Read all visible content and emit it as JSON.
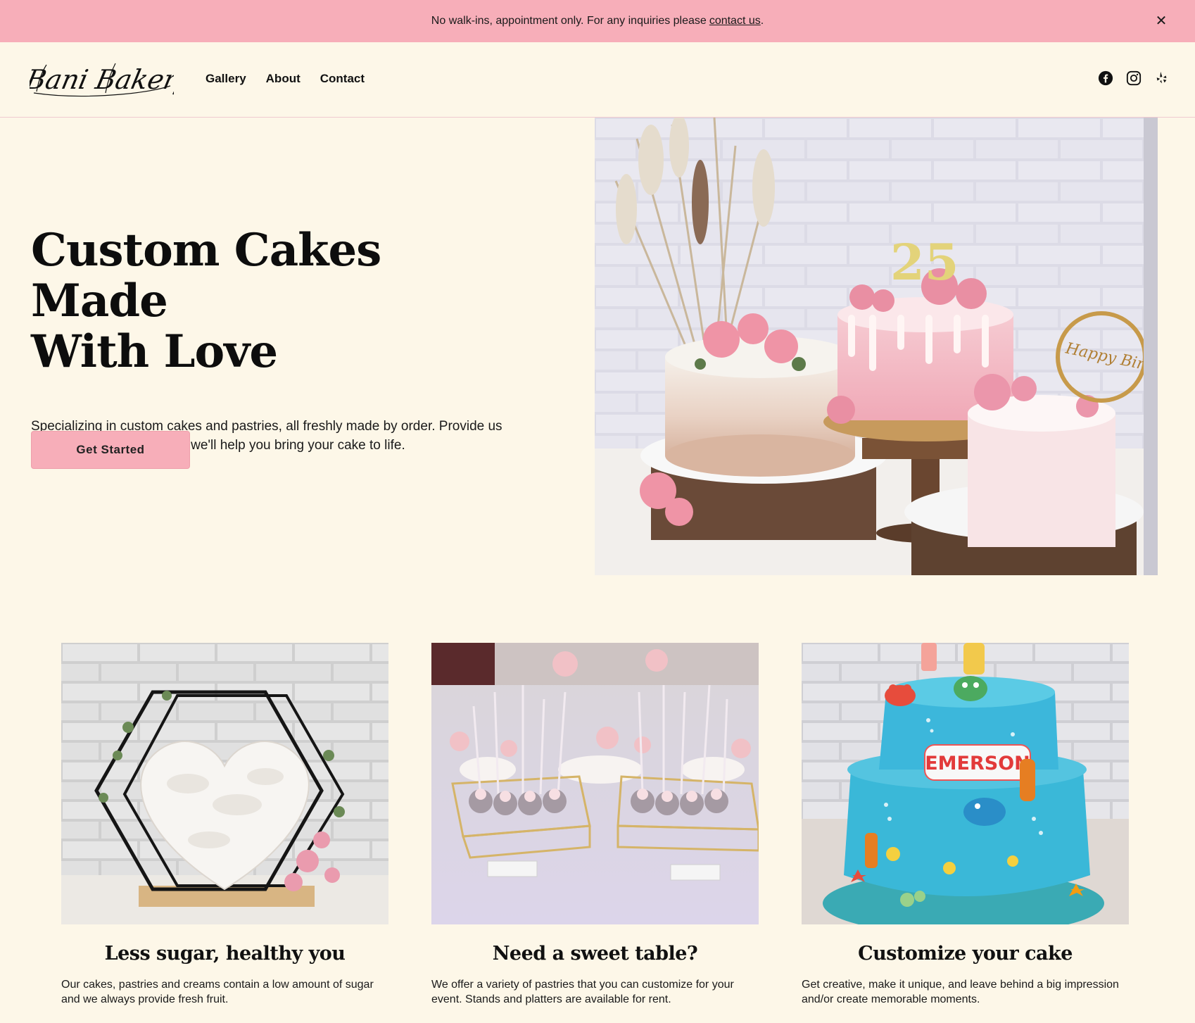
{
  "announcement": {
    "text": "No walk-ins, appointment only. For any inquiries please",
    "link_label": "contact us",
    "suffix": ".",
    "close_icon": "close-icon"
  },
  "header": {
    "logo_text": "Bani Bakery",
    "nav": [
      {
        "label": "Gallery"
      },
      {
        "label": "About"
      },
      {
        "label": "Contact"
      }
    ],
    "social": [
      "facebook-icon",
      "instagram-icon",
      "yelp-icon"
    ]
  },
  "hero": {
    "title_line1": "Custom Cakes Made",
    "title_line2": "With Love",
    "description": "Specializing in custom cakes and pastries, all freshly made by order. Provide us your cake design idea and we'll help you bring your cake to life.",
    "cta_label": "Get Started",
    "image_topper": "Happy Birthday",
    "image_number": "25"
  },
  "features": [
    {
      "title": "Less sugar, healthy you",
      "text": "Our cakes, pastries and creams contain a low amount of sugar and we always provide fresh fruit."
    },
    {
      "title": "Need a sweet table?",
      "text": "We offer a variety of pastries that you can customize for your event. Stands and platters are available for rent."
    },
    {
      "title": "Customize your cake",
      "text": "Get creative, make it unique, and leave behind a big impression and/or create memorable moments.",
      "image_label": "EMERSON"
    }
  ],
  "colors": {
    "background": "#fdf7e8",
    "accent_pink": "#f7aeb9",
    "text": "#111111"
  }
}
